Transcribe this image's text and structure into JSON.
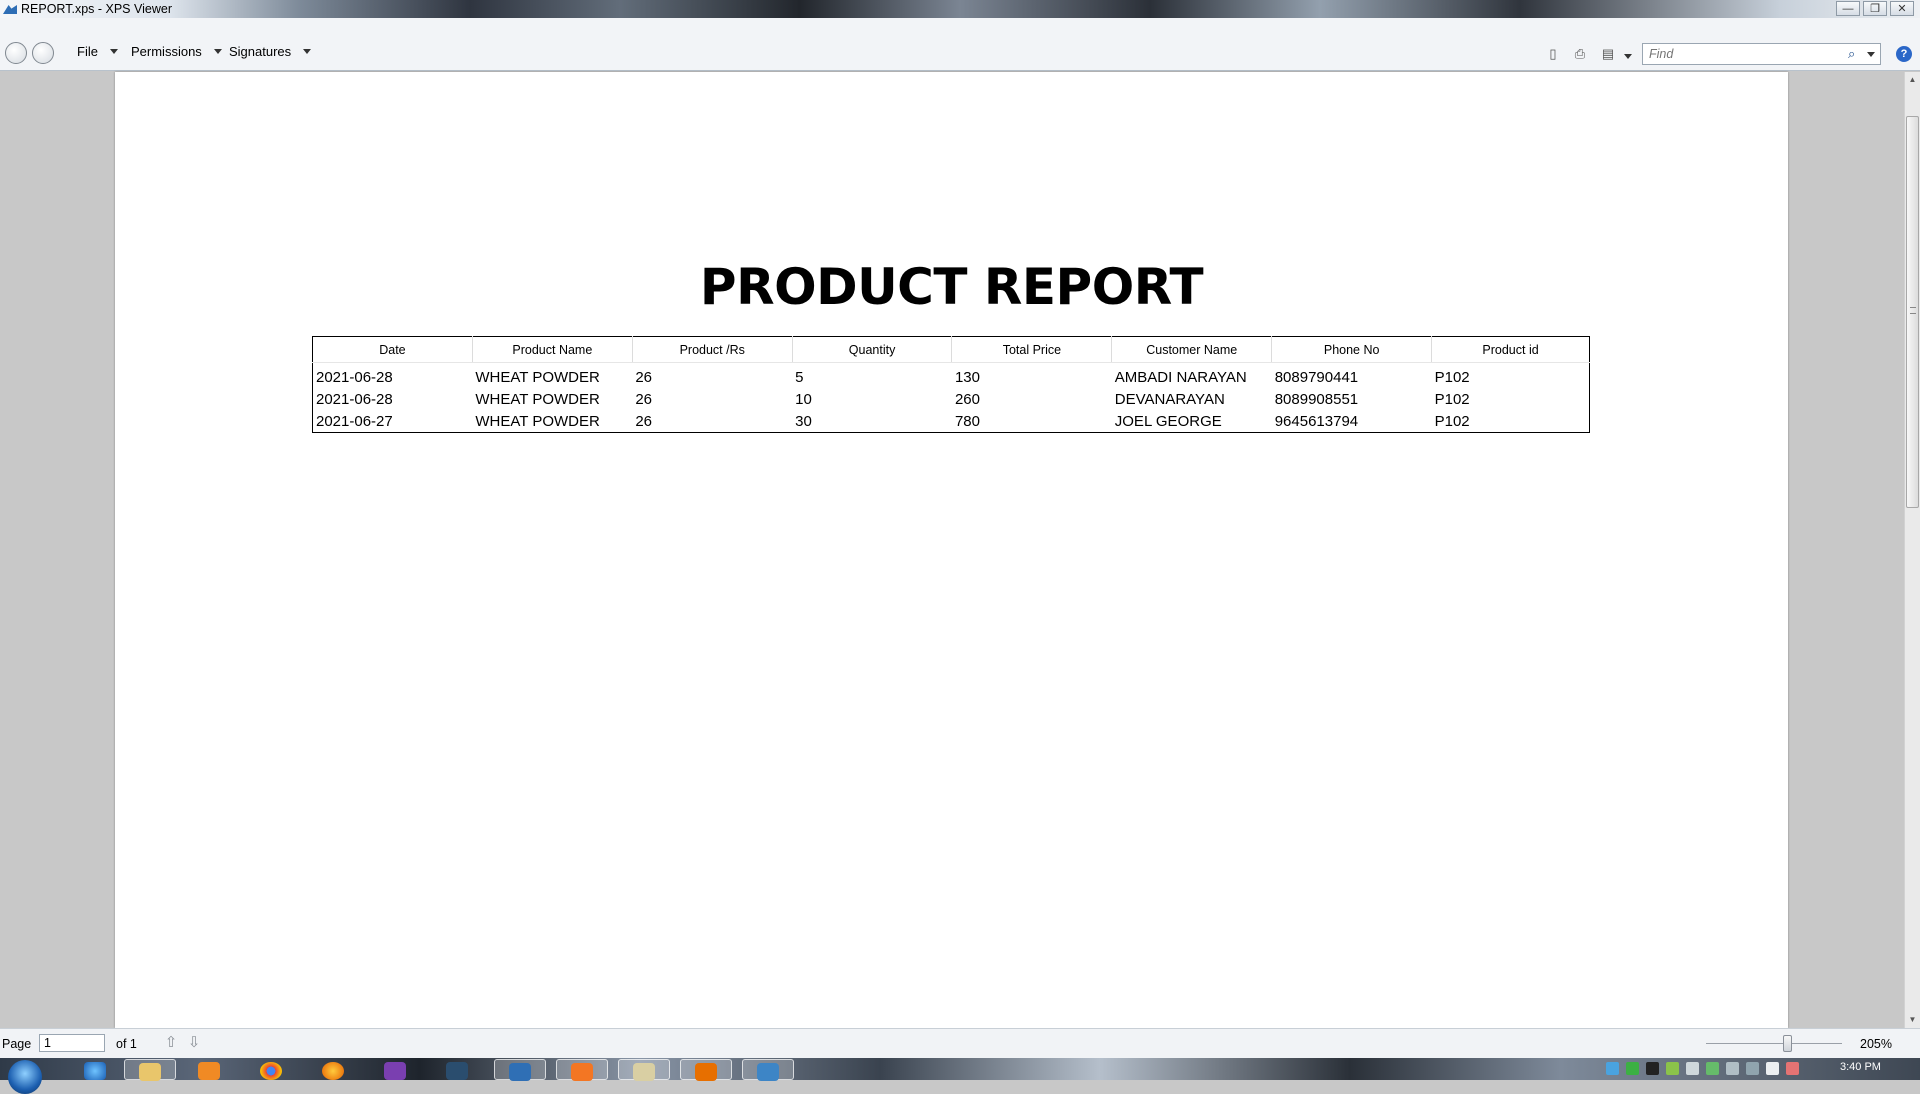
{
  "window": {
    "title": "REPORT.xps - XPS Viewer",
    "controls": {
      "minimize": "—",
      "restore": "❐",
      "close": "✕"
    }
  },
  "menubar": {
    "items": [
      {
        "label": "File"
      },
      {
        "label": "Permissions"
      },
      {
        "label": "Signatures"
      }
    ],
    "find_placeholder": "Find",
    "help_label": "?"
  },
  "document": {
    "title": "PRODUCT REPORT",
    "table": {
      "headers": [
        "Date",
        "Product Name",
        "Product /Rs",
        "Quantity",
        "Total Price",
        "Customer Name",
        "Phone No",
        "Product id"
      ],
      "rows": [
        [
          "2021-06-28",
          "WHEAT POWDER",
          "26",
          "5",
          "130",
          "AMBADI NARAYAN",
          "8089790441",
          "P102"
        ],
        [
          "2021-06-28",
          "WHEAT POWDER",
          "26",
          "10",
          "260",
          "DEVANARAYAN",
          "8089908551",
          "P102"
        ],
        [
          "2021-06-27",
          "WHEAT POWDER",
          "26",
          "30",
          "780",
          "JOEL GEORGE",
          "9645613794",
          "P102"
        ]
      ]
    }
  },
  "statusbar": {
    "page_label": "Page",
    "page_value": "1",
    "page_of": "of 1",
    "zoom": "205%",
    "zoom_level": 0.6
  },
  "taskbar": {
    "clock": "3:40 PM"
  },
  "colors": {
    "accent": "#2b67c8",
    "page_background": "#c8c8c8"
  }
}
